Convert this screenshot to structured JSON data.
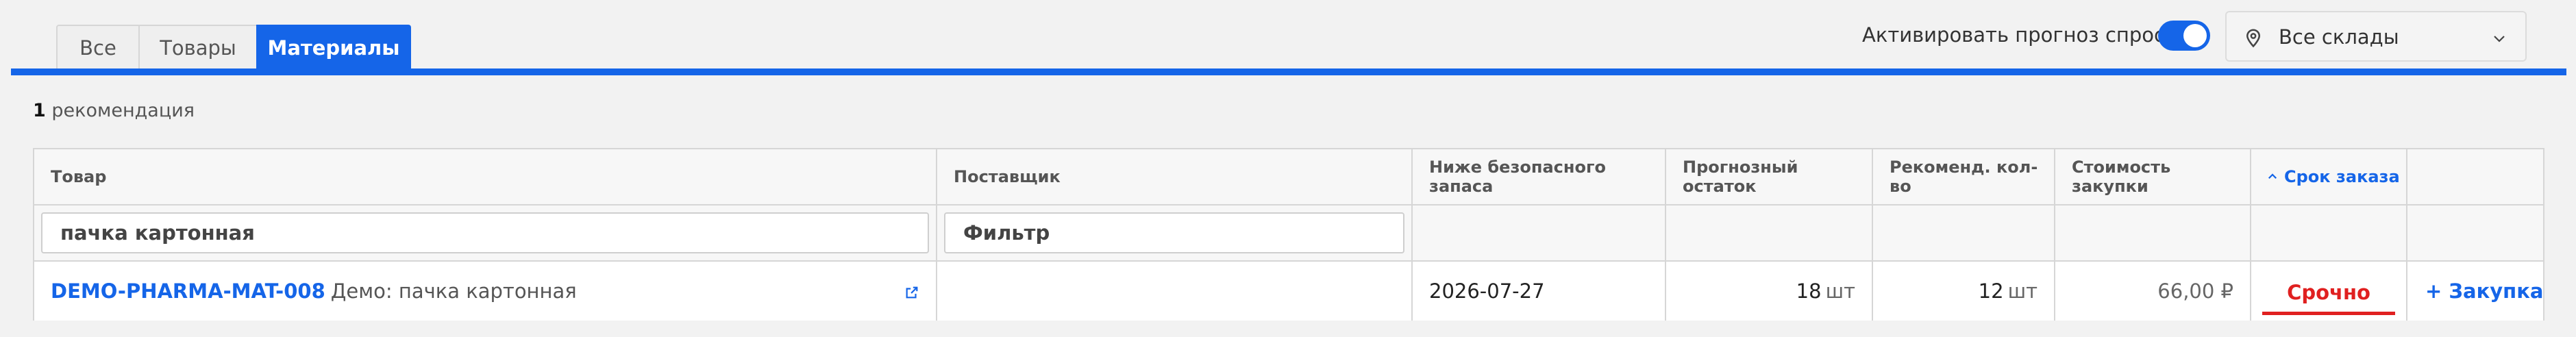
{
  "tabs": [
    {
      "label": "Все",
      "active": false
    },
    {
      "label": "Товары",
      "active": false
    },
    {
      "label": "Материалы",
      "active": true
    }
  ],
  "forecast": {
    "label": "Активировать прогноз спроса",
    "enabled": true
  },
  "warehouse": {
    "selected": "Все склады",
    "icon": "map-pin-icon"
  },
  "summary": {
    "count": "1",
    "label": "рекомендация"
  },
  "table": {
    "headers": {
      "product": "Товар",
      "supplier": "Поставщик",
      "below_safety": "Ниже безопасного запаса",
      "forecast_rest": "Прогнозный остаток",
      "recommended_qty": "Рекоменд. кол-во",
      "purchase_cost": "Стоимость закупки",
      "order_deadline": "Срок заказа"
    },
    "sort": {
      "column": "order_deadline",
      "direction": "asc"
    },
    "filters": {
      "product_value": "пачка картонная",
      "supplier_value": "Фильтр"
    },
    "rows": [
      {
        "sku": "DEMO-PHARMA-MAT-008",
        "name": "Демо: пачка картонная",
        "supplier": "",
        "below_safety": "2026-07-27",
        "forecast_rest": "18",
        "forecast_rest_unit": "шт",
        "recommended_qty": "12",
        "recommended_qty_unit": "шт",
        "purchase_cost": "66,00 ₽",
        "order_deadline": "Срочно",
        "action": "+ Закупка"
      }
    ]
  },
  "colors": {
    "accent": "#1565e8",
    "urgent": "#e02020",
    "background": "#f2f2f2"
  }
}
